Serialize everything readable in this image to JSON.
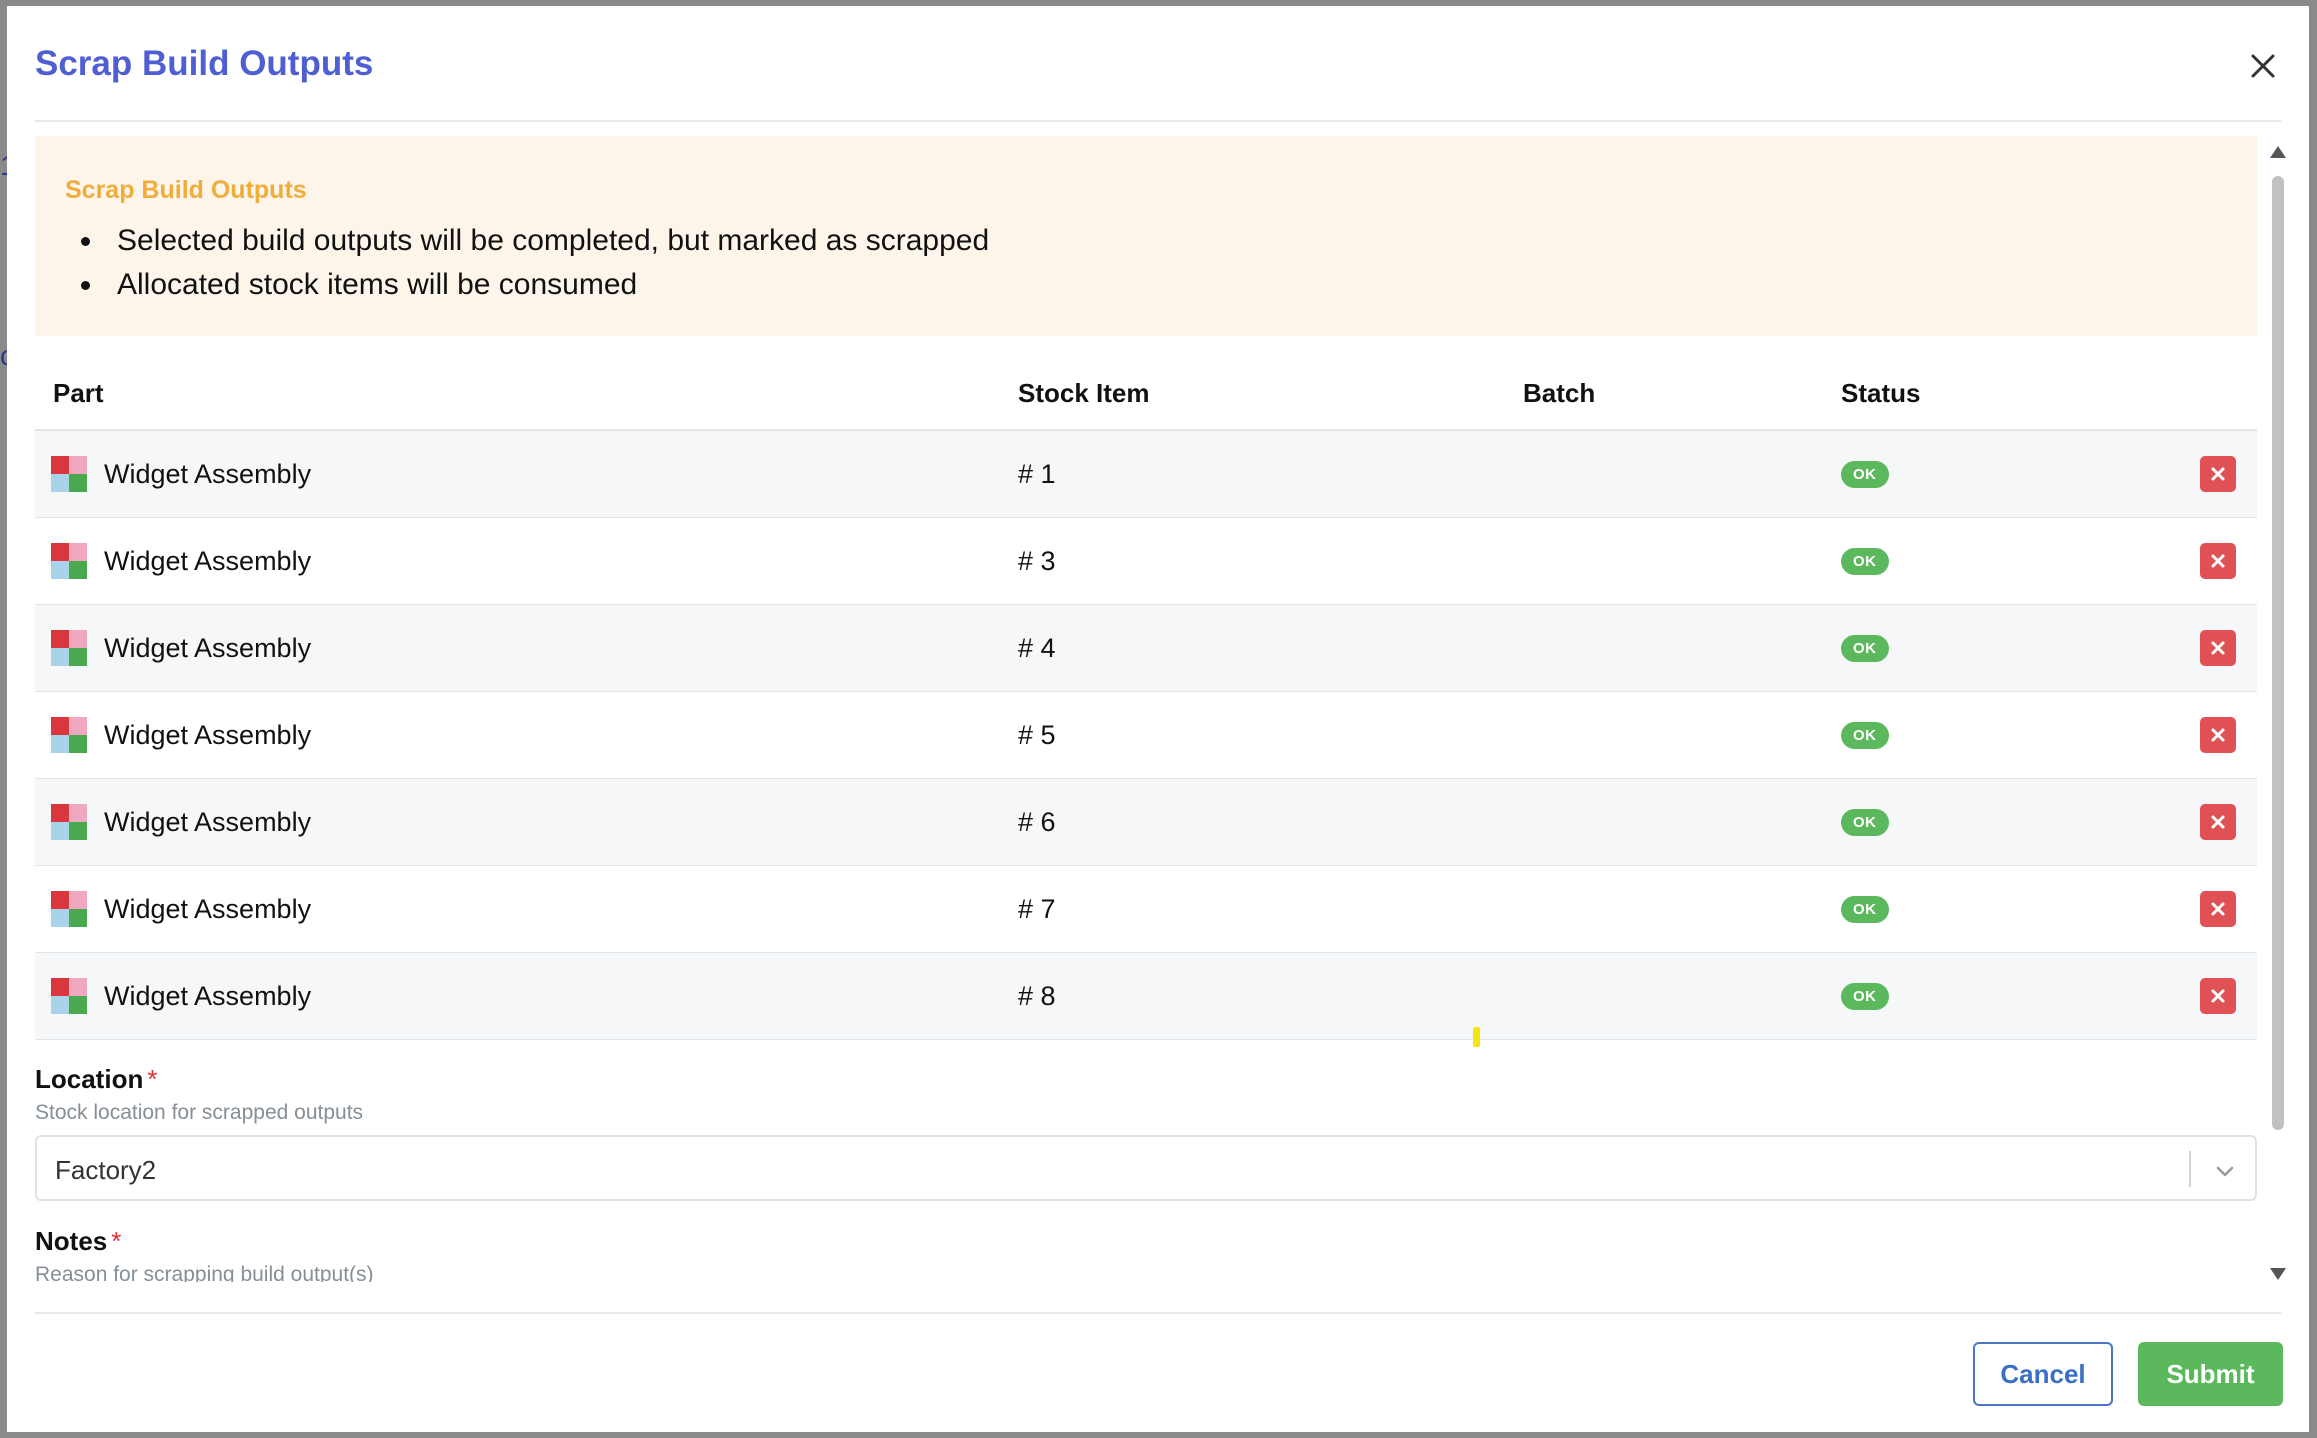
{
  "dialog": {
    "title": "Scrap Build Outputs",
    "close_icon": "close-icon"
  },
  "alert": {
    "title": "Scrap Build Outputs",
    "items": [
      "Selected build outputs will be completed, but marked as scrapped",
      "Allocated stock items will be consumed"
    ]
  },
  "table": {
    "headers": {
      "part": "Part",
      "stock_item": "Stock Item",
      "batch": "Batch",
      "status": "Status"
    },
    "rows": [
      {
        "part": "Widget Assembly",
        "stock_item": "# 1",
        "batch": "",
        "status": "OK"
      },
      {
        "part": "Widget Assembly",
        "stock_item": "# 3",
        "batch": "",
        "status": "OK"
      },
      {
        "part": "Widget Assembly",
        "stock_item": "# 4",
        "batch": "",
        "status": "OK"
      },
      {
        "part": "Widget Assembly",
        "stock_item": "# 5",
        "batch": "",
        "status": "OK"
      },
      {
        "part": "Widget Assembly",
        "stock_item": "# 6",
        "batch": "",
        "status": "OK"
      },
      {
        "part": "Widget Assembly",
        "stock_item": "# 7",
        "batch": "",
        "status": "OK"
      },
      {
        "part": "Widget Assembly",
        "stock_item": "# 8",
        "batch": "",
        "status": "OK"
      }
    ],
    "status_color": "#5cb85c",
    "remove_icon": "remove-row-icon",
    "remove_color": "#e05155"
  },
  "location": {
    "label": "Location",
    "required_mark": "*",
    "help": "Stock location for scrapped outputs",
    "value": "Factory2"
  },
  "notes": {
    "label": "Notes",
    "required_mark": "*",
    "help": "Reason for scrapping build output(s)"
  },
  "footer": {
    "cancel_label": "Cancel",
    "submit_label": "Submit"
  },
  "colors": {
    "title": "#4f5ed3",
    "alert_bg": "#fdf5ea",
    "alert_title": "#f0ad3c",
    "submit": "#5cb85c",
    "cancel_border": "#4a76c4"
  }
}
